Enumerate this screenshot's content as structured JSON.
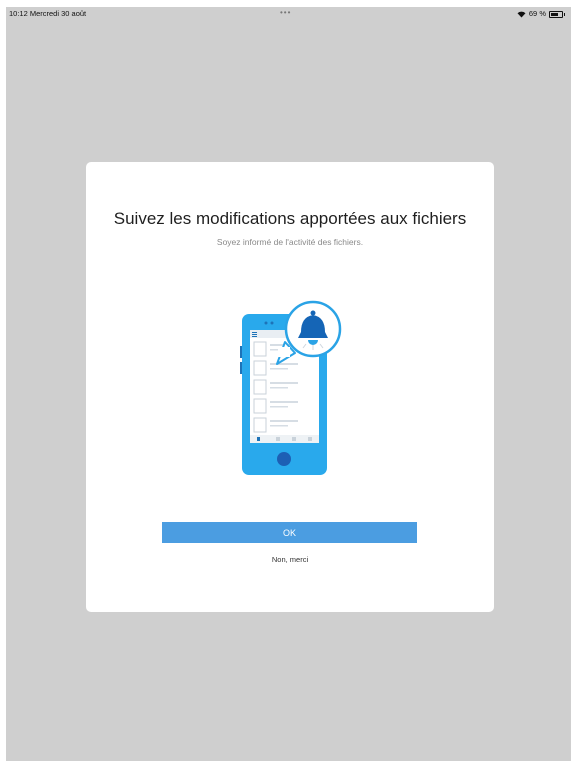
{
  "status_bar": {
    "time_date": "10:12  Mercredi 30 août",
    "center_dots": "•••",
    "battery_text": "69 %",
    "battery_level": 0.69
  },
  "dialog": {
    "title": "Suivez les modifications apportées aux fichiers",
    "subtitle": "Soyez informé de l'activité des fichiers.",
    "illustration": {
      "icons": [
        "phone-icon",
        "bell-icon"
      ],
      "colors": {
        "phone": "#29a9ec",
        "phone_dark": "#1d73b8",
        "bell": "#1565b6",
        "bubble_border": "#2aa3e6"
      }
    },
    "ok_label": "OK",
    "decline_label": "Non, merci"
  },
  "colors": {
    "overlay": "#cfcfcf",
    "accent": "#4b9de1"
  }
}
